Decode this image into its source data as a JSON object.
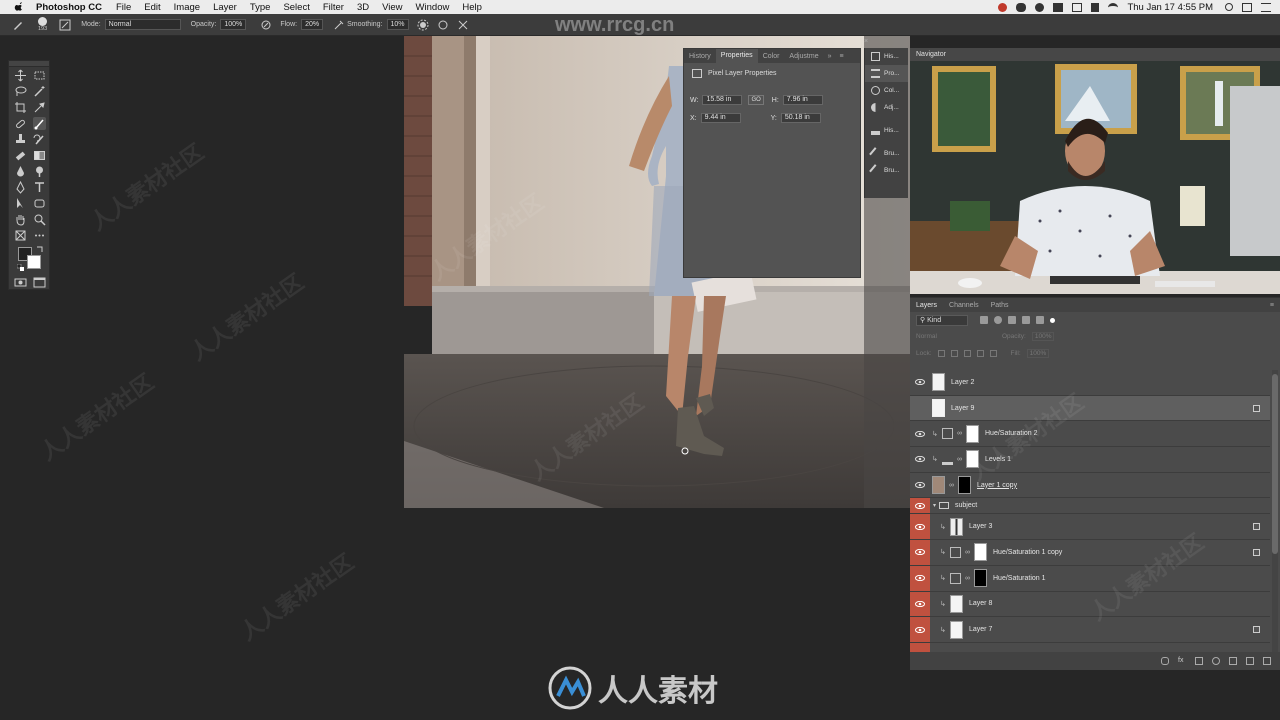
{
  "menubar": {
    "app_name": "Photoshop CC",
    "menus": [
      "File",
      "Edit",
      "Image",
      "Layer",
      "Type",
      "Select",
      "Filter",
      "3D",
      "View",
      "Window",
      "Help"
    ],
    "clock": "Thu Jan 17  4:55 PM"
  },
  "options_bar": {
    "brush_size": "193",
    "mode_label": "Mode:",
    "mode_value": "Normal",
    "opacity_label": "Opacity:",
    "opacity_value": "100%",
    "flow_label": "Flow:",
    "flow_value": "20%",
    "smoothing_label": "Smoothing:",
    "smoothing_value": "10%"
  },
  "properties_panel": {
    "tabs": [
      "History",
      "Properties",
      "Color",
      "Adjustme"
    ],
    "active_tab": "Properties",
    "subtitle": "Pixel Layer Properties",
    "w_label": "W:",
    "w_value": "15.58 in",
    "go_label": "GO",
    "h_label": "H:",
    "h_value": "7.96 in",
    "x_label": "X:",
    "x_value": "9.44 in",
    "y_label": "Y:",
    "y_value": "50.18 in"
  },
  "dock": {
    "items": [
      "His...",
      "Pro...",
      "Col...",
      "Adj...",
      "His...",
      "Bru...",
      "Bru..."
    ]
  },
  "navigator": {
    "title": "Navigator"
  },
  "layers_panel": {
    "tabs": [
      "Layers",
      "Channels",
      "Paths"
    ],
    "kind_label": "Kind",
    "blend_value": "Normal",
    "opacity_label": "Opacity:",
    "opacity_value": "100%",
    "lock_label": "Lock:",
    "fill_label": "Fill:",
    "fill_value": "100%",
    "layers": [
      {
        "name": "Layer 2",
        "visible": true,
        "red": false
      },
      {
        "name": "Layer 9",
        "visible": false,
        "red": false,
        "selected": true
      },
      {
        "name": "Hue/Saturation 2",
        "visible": true,
        "red": false
      },
      {
        "name": "Levels 1",
        "visible": true,
        "red": false
      },
      {
        "name": "Layer 1 copy",
        "visible": true,
        "red": false
      },
      {
        "name": "subject",
        "visible": true,
        "red": true
      },
      {
        "name": "Layer 3",
        "visible": true,
        "red": true
      },
      {
        "name": "Hue/Saturation 1 copy",
        "visible": true,
        "red": true
      },
      {
        "name": "Hue/Saturation 1",
        "visible": true,
        "red": true
      },
      {
        "name": "Layer 8",
        "visible": true,
        "red": true
      },
      {
        "name": "Layer 7",
        "visible": true,
        "red": true
      }
    ]
  },
  "watermarks": {
    "url": "www.rrcg.cn",
    "logo_text": "人人素材",
    "tile_text": "人人素材社区"
  },
  "colors": {
    "accent_red": "#c0513f",
    "panel": "#4b4b4b",
    "background": "#262626"
  }
}
